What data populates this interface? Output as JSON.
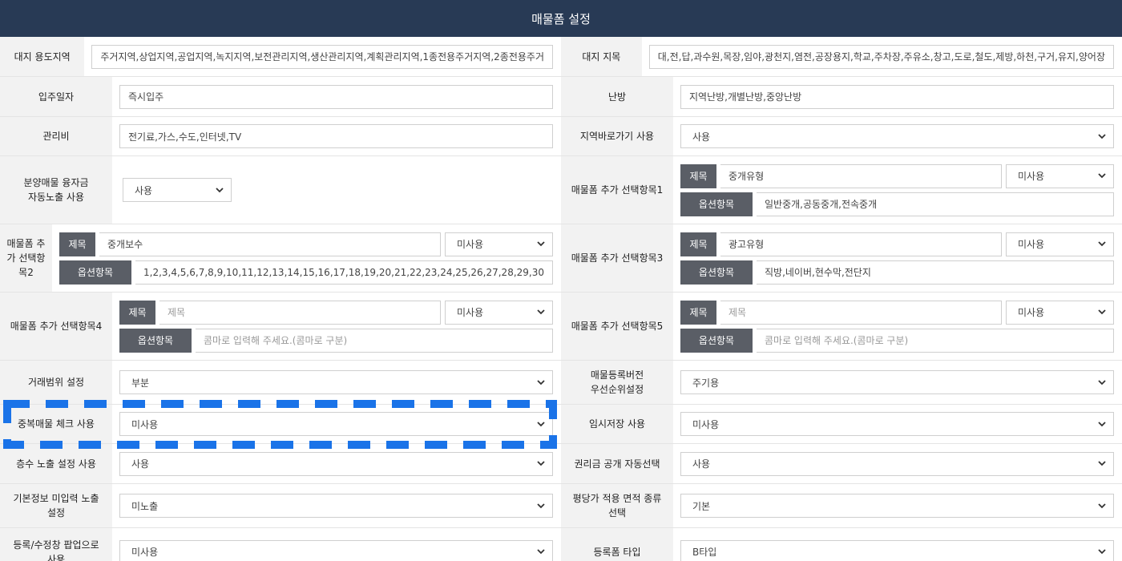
{
  "header": {
    "title": "매물폼 설정"
  },
  "rows": [
    {
      "left": {
        "label": "대지 용도지역",
        "value": "주거지역,상업지역,공업지역,녹지지역,보전관리지역,생산관리지역,계획관리지역,1종전용주거지역,2종전용주거"
      },
      "right": {
        "label": "대지 지목",
        "value": "대,전,답,과수원,목장,임야,광천지,염전,공장용지,학교,주차장,주유소,창고,도로,철도,제방,하천,구거,유지,양어장"
      }
    },
    {
      "left": {
        "label": "입주일자",
        "value": "즉시입주"
      },
      "right": {
        "label": "난방",
        "value": "지역난방,개별난방,중앙난방"
      }
    },
    {
      "left": {
        "label": "관리비",
        "value": "전기료,가스,수도,인터넷,TV"
      },
      "right": {
        "label": "지역바로가기 사용",
        "value": "사용"
      }
    },
    {
      "left": {
        "label": "분양매물 융자금\n자동노출 사용",
        "value": "사용"
      },
      "right": {
        "label": "매물폼 추가 선택항목1",
        "title_tag": "제목",
        "title_value": "중개유형",
        "use_value": "미사용",
        "option_tag": "옵션항목",
        "option_value": "일반중개,공동중개,전속중개"
      }
    },
    {
      "left": {
        "label": "매물폼 추가 선택항목2",
        "title_tag": "제목",
        "title_value": "중개보수",
        "use_value": "미사용",
        "option_tag": "옵션항목",
        "option_value": "1,2,3,4,5,6,7,8,9,10,11,12,13,14,15,16,17,18,19,20,21,22,23,24,25,26,27,28,29,30"
      },
      "right": {
        "label": "매물폼 추가 선택항목3",
        "title_tag": "제목",
        "title_value": "광고유형",
        "use_value": "미사용",
        "option_tag": "옵션항목",
        "option_value": "직방,네이버,현수막,전단지"
      }
    },
    {
      "left": {
        "label": "매물폼 추가 선택항목4",
        "title_tag": "제목",
        "title_placeholder": "제목",
        "use_value": "미사용",
        "option_tag": "옵션항목",
        "option_placeholder": "콤마로 입력해 주세요.(콤마로 구분)"
      },
      "right": {
        "label": "매물폼 추가 선택항목5",
        "title_tag": "제목",
        "title_placeholder": "제목",
        "use_value": "미사용",
        "option_tag": "옵션항목",
        "option_placeholder": "콤마로 입력해 주세요.(콤마로 구분)"
      }
    },
    {
      "left": {
        "label": "거래범위 설정",
        "value": "부분"
      },
      "right": {
        "label": "매물등록버전\n우선순위설정",
        "value": "주기용"
      }
    },
    {
      "left": {
        "label": "중복매물 체크 사용",
        "value": "미사용"
      },
      "right": {
        "label": "임시저장 사용",
        "value": "미사용"
      }
    },
    {
      "left": {
        "label": "층수 노출 설정 사용",
        "value": "사용"
      },
      "right": {
        "label": "권리금 공개 자동선택",
        "value": "사용"
      }
    },
    {
      "left": {
        "label": "기본정보 미입력 노출\n설정",
        "value": "미노출"
      },
      "right": {
        "label": "평당가 적용 면적 종류\n선택",
        "value": "기본"
      }
    },
    {
      "left": {
        "label": "등록/수정창 팝업으로\n사용",
        "value": "미사용"
      },
      "right": {
        "label": "등록폼 타입",
        "value": "B타입"
      }
    }
  ],
  "highlight_color": "#1a73e8",
  "icons": {
    "select_arrow": "chevron-down-icon"
  }
}
